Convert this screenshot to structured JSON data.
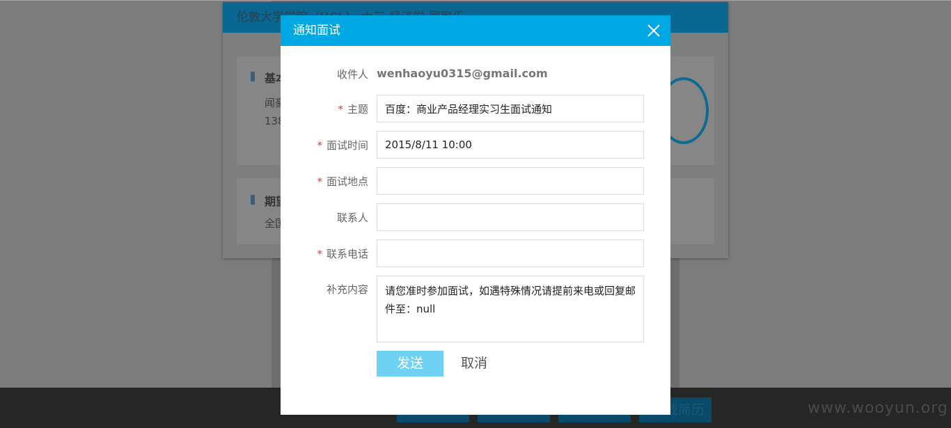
{
  "background": {
    "card_title": "伦敦大学学院（UCL） 大三 经济学 顾家乐",
    "section1": {
      "title": "基本信息",
      "line1": "闻豪宇",
      "line2": "138"
    },
    "section2": {
      "title": "期望工作",
      "line1": "全国"
    },
    "bottom_buttons": [
      "",
      "",
      "",
      "下载简历"
    ],
    "watermark": "www.wooyun.org"
  },
  "dialog": {
    "title": "通知面试",
    "close_icon": "close-icon",
    "recipient_label": "收件人",
    "recipient_value": "wenhaoyu0315@gmail.com",
    "subject": {
      "label": "主题",
      "required": "*",
      "value": "百度：商业产品经理实习生面试通知"
    },
    "interview_time": {
      "label": "面试时间",
      "required": "*",
      "value": "2015/8/11 10:00"
    },
    "interview_location": {
      "label": "面试地点",
      "required": "*",
      "value": ""
    },
    "contact_person": {
      "label": "联系人",
      "value": ""
    },
    "contact_phone": {
      "label": "联系电话",
      "required": "*",
      "value": ""
    },
    "extra": {
      "label": "补充内容",
      "value": "请您准时参加面试，如遇特殊情况请提前来电或回复邮件至：null"
    },
    "send_label": "发送",
    "cancel_label": "取消"
  },
  "colors": {
    "header": "#00a8e3",
    "send_button": "#6fd1f3",
    "required_mark": "#e8382f",
    "overlay": "#7d7d7d"
  }
}
